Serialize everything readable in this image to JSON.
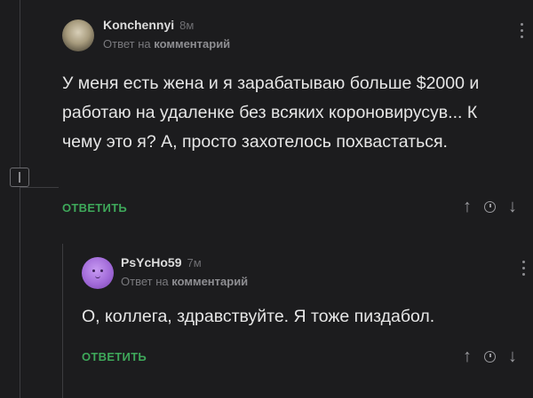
{
  "comments": [
    {
      "author": "Konchennyi",
      "time": "8м",
      "reply_prefix": "Ответ на",
      "reply_target": "комментарий",
      "text": "У меня есть жена и я зарабатываю больше $2000 и работаю на удаленке без всяких короновирусув... К чему это я? А, просто захотелось похвастаться.",
      "reply_label": "ОТВЕТИТЬ",
      "icons": {
        "up": "↑",
        "down": "↓"
      }
    },
    {
      "author": "PsYcHo59",
      "time": "7м",
      "reply_prefix": "Ответ на",
      "reply_target": "комментарий",
      "text": "О, коллега, здравствуйте. Я тоже пиздабол.",
      "reply_label": "ОТВЕТИТЬ",
      "icons": {
        "up": "↑",
        "down": "↓"
      }
    }
  ],
  "colors": {
    "background": "#1c1c1e",
    "accent_green": "#3ea85a"
  }
}
